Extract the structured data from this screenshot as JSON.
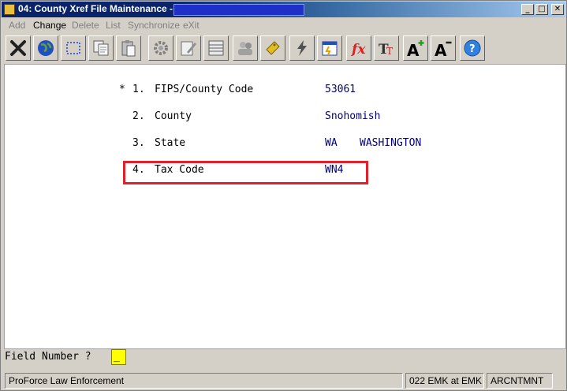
{
  "window": {
    "title": "04: County Xref File Maintenance -",
    "minimize": "_",
    "maximize": "□",
    "close": "✕"
  },
  "menu": {
    "items": [
      {
        "label": "Add",
        "disabled": true
      },
      {
        "label": "Change",
        "disabled": false
      },
      {
        "label": "Delete",
        "disabled": true
      },
      {
        "label": "List",
        "disabled": true
      },
      {
        "label": "Synchronize",
        "disabled": true
      },
      {
        "label": "eXit",
        "disabled": true
      }
    ]
  },
  "toolbar": {
    "icons": [
      "close-x-icon",
      "globe-icon",
      "select-rectangle-icon",
      "copy-icon",
      "paste-icon",
      "settings-gear-icon",
      "edit-pencil-icon",
      "list-grid-icon",
      "users-icon",
      "link-tag-icon",
      "lightning-icon",
      "calendar-icon",
      "function-fx-icon",
      "text-size-icon",
      "font-increase-icon",
      "font-decrease-icon",
      "help-icon"
    ]
  },
  "fields": [
    {
      "marker": "*",
      "number": "1.",
      "label": "FIPS/County Code",
      "value": "53061"
    },
    {
      "marker": "",
      "number": "2.",
      "label": "County",
      "value": "Snohomish"
    },
    {
      "marker": "",
      "number": "3.",
      "label": "State",
      "value": "WA",
      "value2": "WASHINGTON"
    },
    {
      "marker": "",
      "number": "4.",
      "label": "Tax Code",
      "value": "WN4"
    }
  ],
  "prompt": {
    "label": "Field Number ?",
    "value": "_"
  },
  "status": {
    "company": "ProForce Law Enforcement",
    "user": "022 EMK at EMK",
    "program": "ARCNTMNT"
  }
}
